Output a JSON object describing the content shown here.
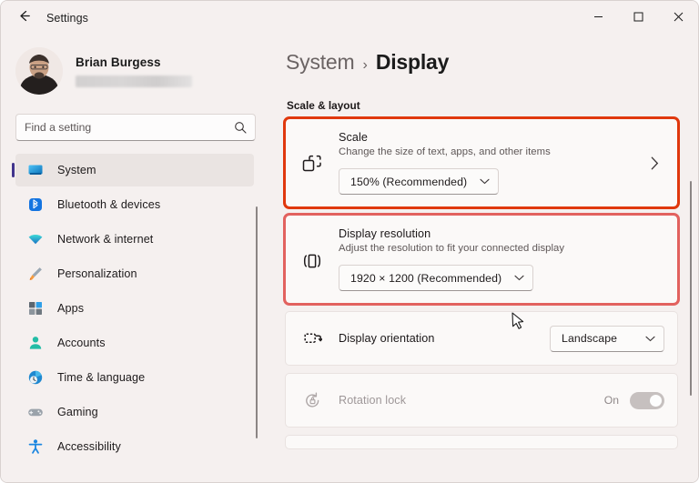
{
  "window": {
    "title": "Settings",
    "back_icon": "back-arrow-icon",
    "minimize_label": "–",
    "maximize_label": "☐",
    "close_label": "✕"
  },
  "sidebar": {
    "profile": {
      "name": "Brian Burgess",
      "email_redacted": ""
    },
    "search": {
      "placeholder": "Find a setting",
      "value": "",
      "icon": "search-icon"
    },
    "items": [
      {
        "label": "System",
        "icon": "monitor-icon",
        "active": true
      },
      {
        "label": "Bluetooth & devices",
        "icon": "bluetooth-icon",
        "active": false
      },
      {
        "label": "Network & internet",
        "icon": "wifi-icon",
        "active": false
      },
      {
        "label": "Personalization",
        "icon": "paintbrush-icon",
        "active": false
      },
      {
        "label": "Apps",
        "icon": "apps-icon",
        "active": false
      },
      {
        "label": "Accounts",
        "icon": "person-icon",
        "active": false
      },
      {
        "label": "Time & language",
        "icon": "clock-icon",
        "active": false
      },
      {
        "label": "Gaming",
        "icon": "gamepad-icon",
        "active": false
      },
      {
        "label": "Accessibility",
        "icon": "accessibility-icon",
        "active": false
      }
    ]
  },
  "content": {
    "breadcrumb": {
      "root": "System",
      "separator": "›",
      "current": "Display"
    },
    "section_title": "Scale & layout",
    "scale_card": {
      "title": "Scale",
      "subtitle": "Change the size of text, apps, and other items",
      "value": "150% (Recommended)",
      "icon": "scale-icon",
      "chevron": "›",
      "dropdown_chevron": "⌄",
      "highlight_color": "#e0380d"
    },
    "resolution_card": {
      "title": "Display resolution",
      "subtitle": "Adjust the resolution to fit your connected display",
      "value": "1920 × 1200 (Recommended)",
      "icon": "resolution-icon",
      "highlight_color": "#e2625f"
    },
    "orientation_row": {
      "label": "Display orientation",
      "value": "Landscape",
      "icon": "orientation-icon",
      "dropdown_chevron": "⌄"
    },
    "rotation_lock_row": {
      "label": "Rotation lock",
      "state": "On",
      "icon": "rotation-lock-icon",
      "disabled": true
    }
  }
}
